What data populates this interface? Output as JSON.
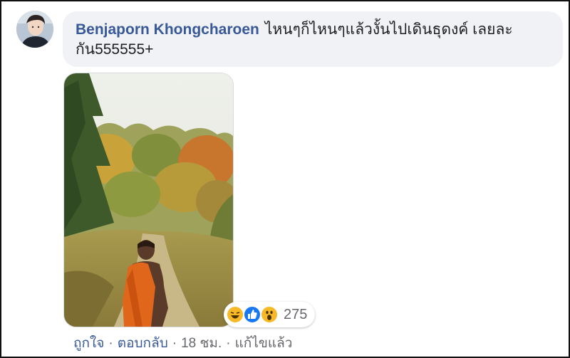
{
  "comment": {
    "author": "Benjaporn Khongcharoen",
    "text": "ไหนๆก็ไหนๆแล้วงั้นไปเดินธุดงค์ เลยละกัน555555+"
  },
  "reactions": {
    "icons": [
      "haha-icon",
      "like-icon",
      "wow-icon"
    ],
    "count": "275"
  },
  "actions": {
    "like": "ถูกใจ",
    "reply": "ตอบกลับ",
    "time": "18 ชม.",
    "edited": "แก้ไขแล้ว",
    "separator": "·"
  },
  "colors": {
    "author": "#385898",
    "bubble": "#f0f2f5",
    "meta": "#65676b"
  }
}
